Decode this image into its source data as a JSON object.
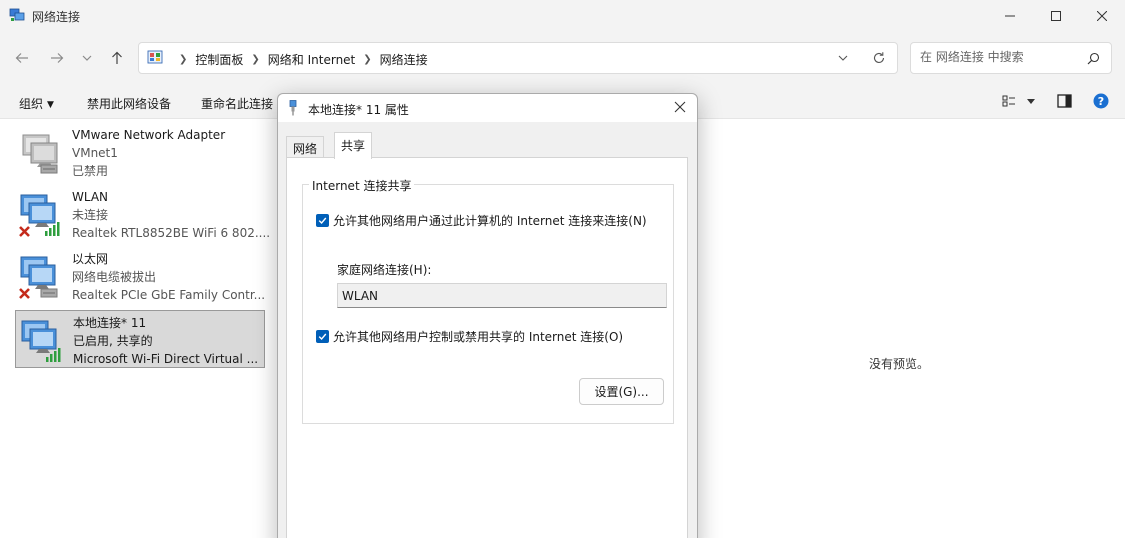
{
  "window": {
    "title": "网络连接"
  },
  "address": {
    "crumbs": [
      "控制面板",
      "网络和 Internet",
      "网络连接"
    ]
  },
  "search": {
    "placeholder": "在 网络连接 中搜索"
  },
  "toolbar": {
    "organize_label": "组织",
    "disable_label": "禁用此网络设备",
    "rename_label": "重命名此连接"
  },
  "connections": [
    {
      "name": "VMware Network Adapter",
      "status": "VMnet1",
      "device": "已禁用"
    },
    {
      "name": "WLAN",
      "status": "未连接",
      "device": "Realtek RTL8852BE WiFi 6 802...."
    },
    {
      "name": "以太网",
      "status": "网络电缆被拔出",
      "device": "Realtek PCIe GbE Family Contr..."
    },
    {
      "name": "本地连接* 11",
      "status": "已启用, 共享的",
      "device": "Microsoft Wi-Fi Direct Virtual ..."
    }
  ],
  "preview": {
    "text": "没有预览。"
  },
  "dialog": {
    "title": "本地连接* 11 属性",
    "tabs": [
      "网络",
      "共享"
    ],
    "active_tab": "共享",
    "group_title": "Internet 连接共享",
    "allow_share_label": "允许其他网络用户通过此计算机的 Internet 连接来连接(N)",
    "allow_share_checked": true,
    "home_network_label": "家庭网络连接(H):",
    "home_network_value": "WLAN",
    "allow_control_label": "允许其他网络用户控制或禁用共享的 Internet 连接(O)",
    "allow_control_checked": true,
    "settings_button": "设置(G)..."
  },
  "colors": {
    "accent": "#005fb8",
    "selection": "#d9d9d9",
    "error_x": "#c42b1c",
    "signal": "#2e9e3e"
  }
}
